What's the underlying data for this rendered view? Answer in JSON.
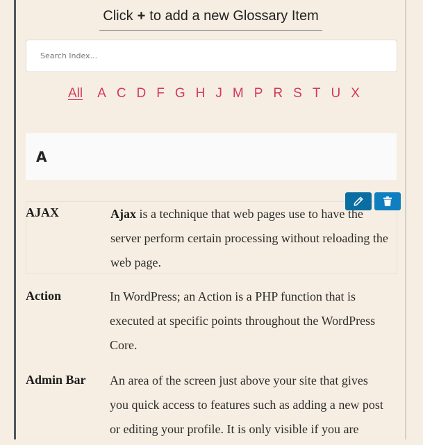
{
  "header": {
    "add_hint_prefix": "Click",
    "add_hint_icon": "+",
    "add_hint_suffix": "to add a new Glossary Item"
  },
  "search": {
    "placeholder": "Search Index...",
    "value": ""
  },
  "alphabet_nav": {
    "active": "All",
    "items": [
      "All",
      "A",
      "C",
      "D",
      "F",
      "G",
      "H",
      "J",
      "M",
      "P",
      "R",
      "S",
      "T",
      "U",
      "X"
    ],
    "color": "#d23a58"
  },
  "section": {
    "letter": "A"
  },
  "actions": {
    "edit_icon": "pencil-icon",
    "delete_icon": "trash-icon",
    "edit_color": "#0a6ea3",
    "delete_color": "#0f7fc0"
  },
  "entries": [
    {
      "term": "AJAX",
      "definition_bold": "Ajax",
      "definition": " is a technique that web pages use to have the server perform certain processing without reloading the web page."
    },
    {
      "term": "Action",
      "definition_bold": "",
      "definition": "In WordPress; an Action is a PHP function that is executed at specific points throughout the WordPress Core."
    },
    {
      "term": "Admin Bar",
      "definition_bold": "",
      "definition": "An area of the screen just above your site that gives you quick access to features such as adding a new post or editing your profile. It is only visible if you are"
    }
  ]
}
